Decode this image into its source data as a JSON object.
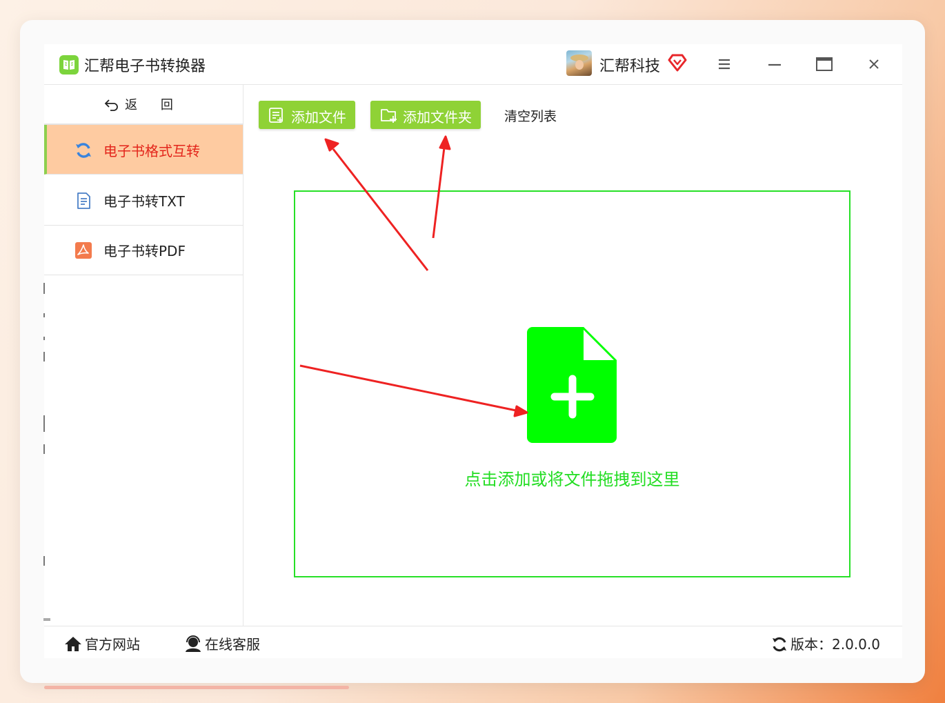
{
  "app": {
    "title": "汇帮电子书转换器"
  },
  "user": {
    "name": "汇帮科技"
  },
  "window_controls": {
    "menu": "menu-icon",
    "minimize": "minimize-icon",
    "maximize": "maximize-icon",
    "close": "close-icon"
  },
  "sidebar": {
    "back_label": "返 回",
    "items": [
      {
        "label": "电子书格式互转",
        "icon": "refresh-icon",
        "active": true
      },
      {
        "label": "电子书转TXT",
        "icon": "document-icon",
        "active": false
      },
      {
        "label": "电子书转PDF",
        "icon": "pdf-icon",
        "active": false
      }
    ]
  },
  "toolbar": {
    "add_file": "添加文件",
    "add_folder": "添加文件夹",
    "clear_list": "清空列表"
  },
  "dropzone": {
    "hint": "点击添加或将文件拖拽到这里"
  },
  "footer": {
    "website": "官方网站",
    "support": "在线客服",
    "version": "版本：2.0.0.0"
  },
  "colors": {
    "accent_green": "#8fd236",
    "drop_green": "#00ff00",
    "active_bg": "#fecba1",
    "active_text": "#e3251b",
    "annotation_arrow": "#ee2222"
  }
}
